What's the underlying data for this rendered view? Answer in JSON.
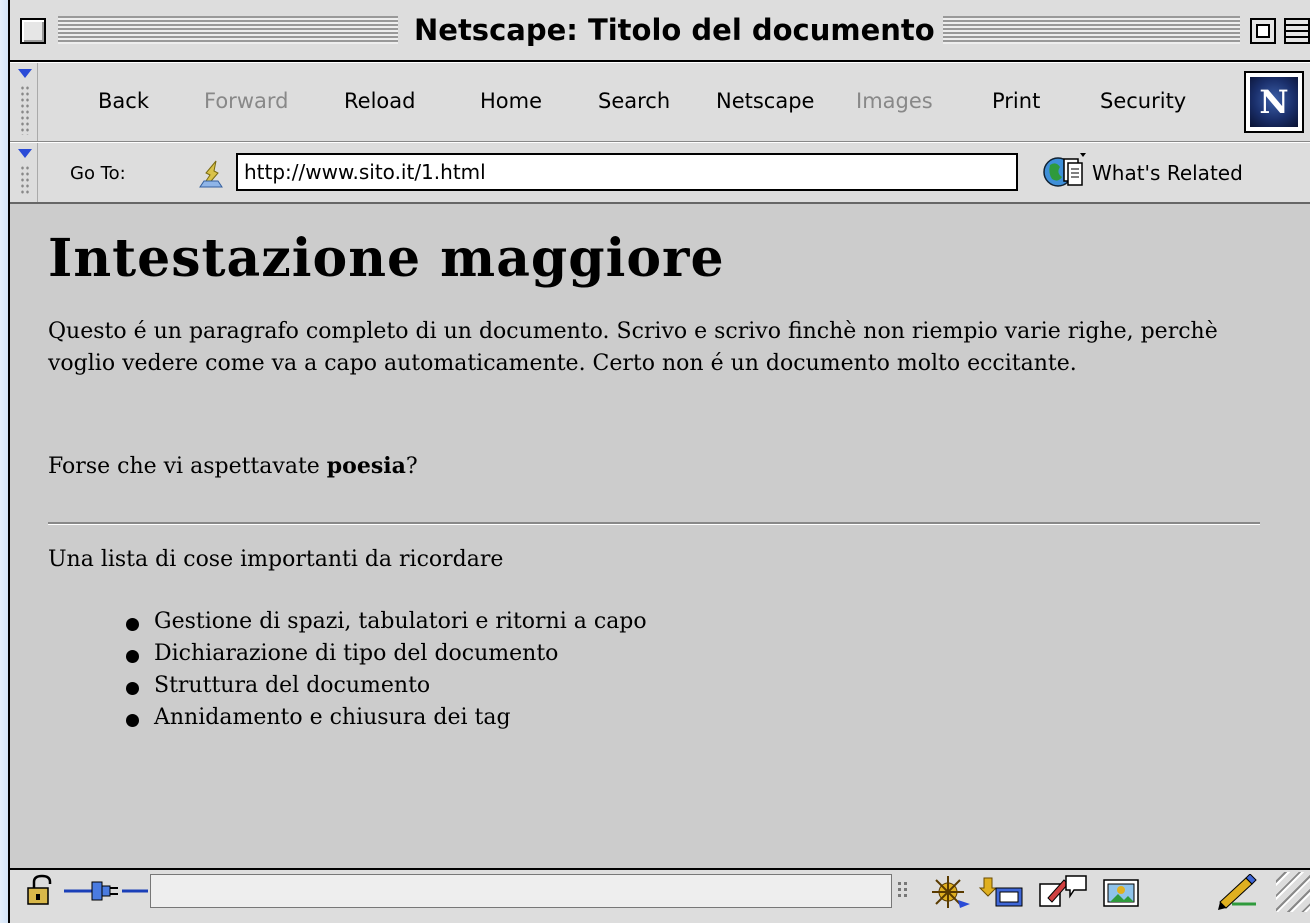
{
  "window": {
    "title": "Netscape: Titolo del documento"
  },
  "nav_toolbar": {
    "buttons": [
      {
        "label": "Back",
        "enabled": true
      },
      {
        "label": "Forward",
        "enabled": false
      },
      {
        "label": "Reload",
        "enabled": true
      },
      {
        "label": "Home",
        "enabled": true
      },
      {
        "label": "Search",
        "enabled": true
      },
      {
        "label": "Netscape",
        "enabled": true
      },
      {
        "label": "Images",
        "enabled": false
      },
      {
        "label": "Print",
        "enabled": true
      },
      {
        "label": "Security",
        "enabled": true
      }
    ],
    "logo_letter": "N"
  },
  "location_toolbar": {
    "goto_label": "Go To:",
    "url": "http://www.sito.it/1.html",
    "related_label": "What's Related"
  },
  "page": {
    "heading": "Intestazione maggiore",
    "paragraph1": "Questo é un paragrafo completo di un documento. Scrivo e scrivo finchè non riempio varie righe, perchè voglio vedere come va a capo automaticamente. Certo non é un documento molto eccitante.",
    "paragraph2_before": "Forse che vi aspettavate ",
    "paragraph2_bold": "poesia",
    "paragraph2_after": "?",
    "list_intro": "Una lista di cose importanti da ricordare",
    "list_items": [
      "Gestione di spazi, tabulatori e ritorni a capo",
      "Dichiarazione di tipo del documento",
      "Struttura del documento",
      "Annidamento e chiusura dei tag"
    ]
  },
  "status_bar": {
    "status_text": "",
    "icons": [
      "security-lock-icon",
      "connection-plug-icon",
      "component-bar-grip-icon",
      "navigator-icon",
      "mail-icon",
      "composer-icon",
      "discussion-icon",
      "addressbook-icon",
      "edit-icon"
    ]
  },
  "colors": {
    "page_background": "#cccccc",
    "chrome_background": "#dddddd",
    "accent_blue": "#2a4bd7"
  }
}
